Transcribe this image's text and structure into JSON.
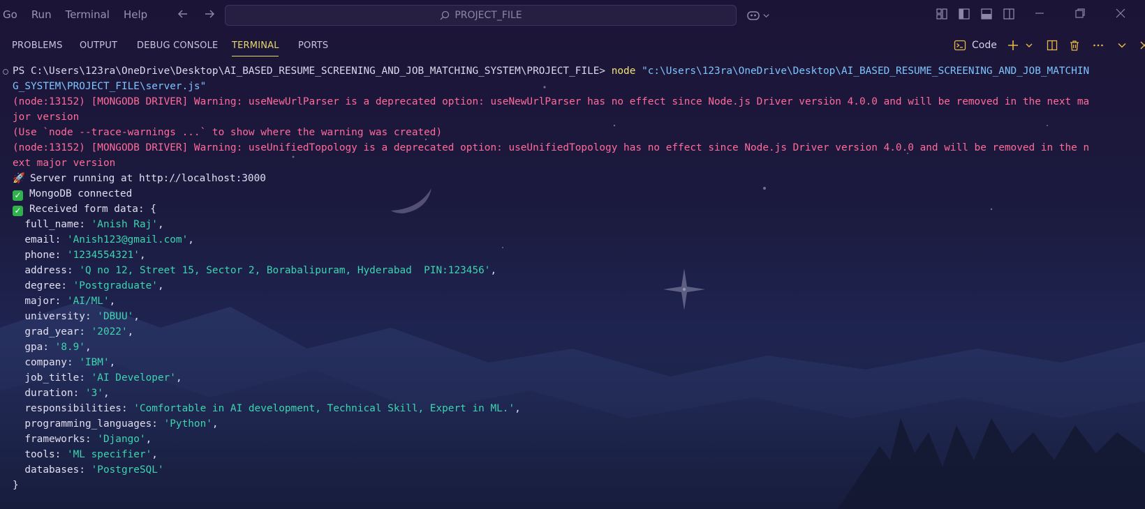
{
  "menu": [
    "Go",
    "Run",
    "Terminal",
    "Help"
  ],
  "command_center": {
    "label": "PROJECT_FILE"
  },
  "panel": {
    "tabs": [
      "PROBLEMS",
      "OUTPUT",
      "DEBUG CONSOLE",
      "TERMINAL",
      "PORTS"
    ],
    "active_tab": "TERMINAL",
    "terminal_profile": "Code"
  },
  "terminal": {
    "prompt_prefix": "PS C:\\Users\\123ra\\OneDrive\\Desktop\\AI_BASED_RESUME_SCREENING_AND_JOB_MATCHING_SYSTEM\\PROJECT_FILE>",
    "command": "node",
    "command_arg_part1": "\"c:\\Users\\123ra\\OneDrive\\Desktop\\AI_BASED_RESUME_SCREENING_AND_JOB_MATCHIN",
    "command_arg_part2": "G_SYSTEM\\PROJECT_FILE\\server.js\"",
    "warn1_a": "(node:13152) [MONGODB DRIVER] Warning: useNewUrlParser is a deprecated option: useNewUrlParser has no effect since Node.js Driver version 4.0.0 and will be removed in the next ma",
    "warn1_b": "jor version",
    "trace_hint": "(Use `node --trace-warnings ...` to show where the warning was created)",
    "warn2_a": "(node:13152) [MONGODB DRIVER] Warning: useUnifiedTopology is a deprecated option: useUnifiedTopology has no effect since Node.js Driver version 4.0.0 and will be removed in the n",
    "warn2_b": "ext major version",
    "server_running": "Server running at http://localhost:3000",
    "mongo_connected": "MongoDB connected",
    "received": "Received form data: {",
    "form_fields": [
      {
        "key": "full_name",
        "value": "'Anish Raj'",
        "comma": ","
      },
      {
        "key": "email",
        "value": "'Anish123@gmail.com'",
        "comma": ","
      },
      {
        "key": "phone",
        "value": "'1234554321'",
        "comma": ","
      },
      {
        "key": "address",
        "value": "'Q no 12, Street 15, Sector 2, Borabalipuram, Hyderabad  PIN:123456'",
        "comma": ","
      },
      {
        "key": "degree",
        "value": "'Postgraduate'",
        "comma": ","
      },
      {
        "key": "major",
        "value": "'AI/ML'",
        "comma": ","
      },
      {
        "key": "university",
        "value": "'DBUU'",
        "comma": ","
      },
      {
        "key": "grad_year",
        "value": "'2022'",
        "comma": ","
      },
      {
        "key": "gpa",
        "value": "'8.9'",
        "comma": ","
      },
      {
        "key": "company",
        "value": "'IBM'",
        "comma": ","
      },
      {
        "key": "job_title",
        "value": "'AI Developer'",
        "comma": ","
      },
      {
        "key": "duration",
        "value": "'3'",
        "comma": ","
      },
      {
        "key": "responsibilities",
        "value": "'Comfortable in AI development, Technical Skill, Expert in ML.'",
        "comma": ","
      },
      {
        "key": "programming_languages",
        "value": "'Python'",
        "comma": ","
      },
      {
        "key": "frameworks",
        "value": "'Django'",
        "comma": ","
      },
      {
        "key": "tools",
        "value": "'ML specifier'",
        "comma": ","
      },
      {
        "key": "databases",
        "value": "'PostgreSQL'",
        "comma": ""
      }
    ],
    "closing_brace": "}"
  },
  "icons": {
    "search": "search-icon",
    "copilot": "copilot-icon",
    "terminal_profile": "terminal-icon",
    "add_terminal": "plus-icon",
    "split": "split-icon",
    "kill": "trash-icon"
  },
  "colors": {
    "tab_active": "#e7d86b",
    "warning": "#ff6b9a",
    "string": "#3ed4b0",
    "path": "#7fc4ff",
    "check": "#2fb24c"
  }
}
